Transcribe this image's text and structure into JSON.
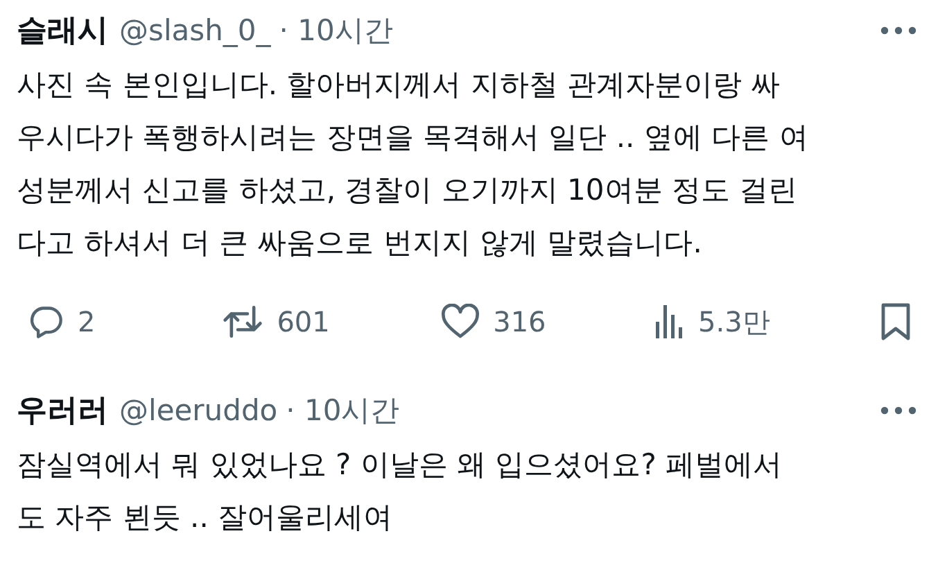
{
  "posts": [
    {
      "name": "슬래시",
      "handle": "@slash_0_",
      "time": "· 10시간",
      "text": "사진 속 본인입니다. 할아버지께서 지하철 관계자분이랑 싸\n우시다가 폭행하시려는 장면을 목격해서 일단 .. 옆에 다른 여\n성분께서 신고를 하셨고, 경찰이 오기까지 10여분 정도 걸린\n다고 하셔서 더 큰 싸움으로 번지지 않게 말렸습니다.",
      "actions": [
        {
          "kind": "reply",
          "count": "2"
        },
        {
          "kind": "repost",
          "count": "601"
        },
        {
          "kind": "like",
          "count": "316"
        },
        {
          "kind": "views",
          "count": "5.3만"
        },
        {
          "kind": "bookmark"
        }
      ]
    },
    {
      "name": "우러러",
      "handle": "@leeruddo",
      "time": "· 10시간",
      "text": "잠실역에서 뭐 있었나요 ? 이날은 왜 입으셨어요?  페벌에서\n도 자주 뵌듯 .. 잘어울리세여"
    }
  ]
}
